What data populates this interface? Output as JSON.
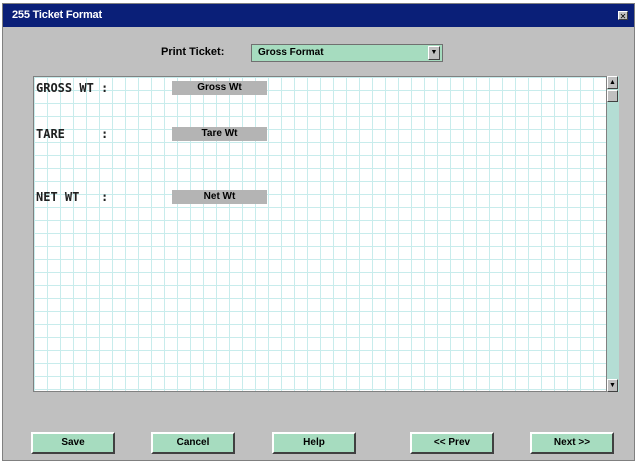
{
  "window": {
    "title": "255 Ticket Format",
    "close_glyph": "✕"
  },
  "print_ticket": {
    "label": "Print Ticket:",
    "selected": "Gross Format",
    "arrow_icon": "▼"
  },
  "fields": [
    {
      "label": "GROSS WT :",
      "value": "Gross Wt"
    },
    {
      "label": "TARE     :",
      "value": "Tare Wt"
    },
    {
      "label": "NET WT   :",
      "value": "Net Wt"
    }
  ],
  "scrollbar": {
    "up_icon": "▲",
    "down_icon": "▼"
  },
  "buttons": {
    "save": "Save",
    "cancel": "Cancel",
    "help": "Help",
    "prev": "<< Prev",
    "next": "Next >>"
  }
}
